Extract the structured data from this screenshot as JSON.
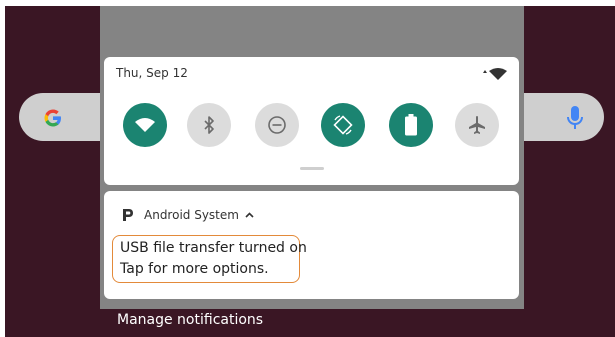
{
  "home": {
    "search_icon": "google-g-logo",
    "mic_icon": "mic-icon"
  },
  "quick_settings": {
    "date": "Thu, Sep 12",
    "status_icons": [
      "signal-indicator-icon",
      "wifi-icon"
    ],
    "tiles": [
      {
        "name": "wifi",
        "icon": "wifi-icon",
        "state": "on"
      },
      {
        "name": "bluetooth",
        "icon": "bluetooth-icon",
        "state": "off"
      },
      {
        "name": "do-not-disturb",
        "icon": "do-not-disturb-icon",
        "state": "off"
      },
      {
        "name": "auto-rotate",
        "icon": "auto-rotate-icon",
        "state": "on"
      },
      {
        "name": "battery-saver",
        "icon": "battery-icon",
        "state": "on"
      },
      {
        "name": "airplane-mode",
        "icon": "airplane-icon",
        "state": "off"
      }
    ]
  },
  "notification": {
    "app_name": "Android System",
    "app_icon": "android-system-icon",
    "title": "USB file transfer turned on",
    "text": "Tap for more options."
  },
  "footer": {
    "manage_label": "Manage notifications"
  },
  "colors": {
    "wallpaper": "#3a1624",
    "tile_on": "#1b8471",
    "tile_off": "#dcdcdc",
    "highlight": "#e38a3a",
    "shade_backdrop": "#848484"
  }
}
